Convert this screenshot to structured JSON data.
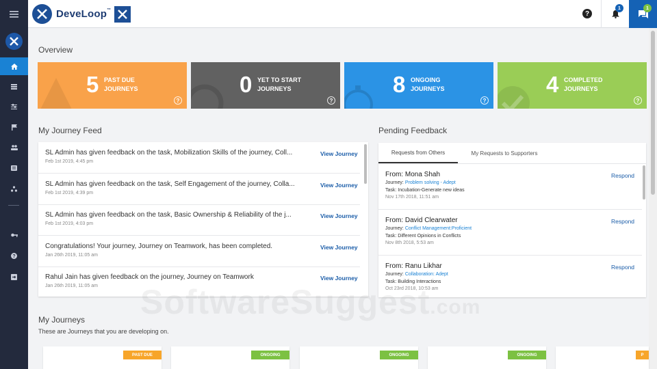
{
  "app": {
    "brand_name": "DeveLoop",
    "brand_tm": "™"
  },
  "sidebar": {
    "items": [
      {
        "name": "home",
        "icon": "home-icon"
      },
      {
        "name": "journeys",
        "icon": "list-icon"
      },
      {
        "name": "filters",
        "icon": "sliders-icon"
      },
      {
        "name": "flags",
        "icon": "flag-icon"
      },
      {
        "name": "people",
        "icon": "people-icon"
      },
      {
        "name": "feedback",
        "icon": "message-icon"
      },
      {
        "name": "network",
        "icon": "network-icon"
      },
      {
        "name": "keys",
        "icon": "key-icon"
      },
      {
        "name": "help",
        "icon": "help-icon"
      },
      {
        "name": "logout",
        "icon": "exit-icon"
      }
    ]
  },
  "topbar": {
    "notification_count": "1",
    "message_count": "1",
    "help_label": "?"
  },
  "overview": {
    "title": "Overview",
    "cards": [
      {
        "value": "5",
        "line1": "PAST DUE",
        "line2": "JOURNEYS",
        "color": "#f9a24a"
      },
      {
        "value": "0",
        "line1": "YET TO START",
        "line2": "JOURNEYS",
        "color": "#616161"
      },
      {
        "value": "8",
        "line1": "ONGOING",
        "line2": "JOURNEYS",
        "color": "#2b93e5"
      },
      {
        "value": "4",
        "line1": "COMPLETED",
        "line2": "JOURNEYS",
        "color": "#9acd56"
      }
    ]
  },
  "feed": {
    "title": "My Journey Feed",
    "link_label": "View Journey",
    "rows": [
      {
        "text": "SL Admin has given feedback on the task, Mobilization Skills of the journey, Coll...",
        "date": "Feb 1st 2019, 4:45 pm"
      },
      {
        "text": "SL Admin has given feedback on the task, Self Engagement of the journey, Colla...",
        "date": "Feb 1st 2019, 4:39 pm"
      },
      {
        "text": "SL Admin has given feedback on the task, Basic Ownership & Reliability of the j...",
        "date": "Feb 1st 2019, 4:03 pm"
      },
      {
        "text": "Congratulations! Your journey, Journey on Teamwork, has been completed.",
        "date": "Jan 26th 2019, 11:05 am"
      },
      {
        "text": "Rahul Jain has given feedback on the journey, Journey on Teamwork",
        "date": "Jan 26th 2019, 11:05 am"
      }
    ]
  },
  "pending": {
    "title": "Pending Feedback",
    "tabs": [
      "Requests from Others",
      "My Requests to Supporters"
    ],
    "respond_label": "Respond",
    "journey_prefix": "Journey:",
    "task_prefix": "Task:",
    "requests": [
      {
        "from": "From: Mona Shah",
        "journey": "Problem solving - Adept",
        "task": "Incubation-Generate new ideas",
        "date": "Nov 17th 2018, 11:51 am"
      },
      {
        "from": "From: David Clearwater",
        "journey": "Conflict Management:Proficient",
        "task": "Different Opinions in Conflicts",
        "date": "Nov 8th 2018, 5:53 am"
      },
      {
        "from": "From: Ranu Likhar",
        "journey": "Collaboration: Adept",
        "task": "Building Interactions",
        "date": "Oct 23rd 2018, 10:53 am"
      }
    ]
  },
  "my_journeys": {
    "title": "My Journeys",
    "subtitle": "These are Journeys that you are developing on.",
    "cards": [
      {
        "status": "PAST DUE",
        "color": "#f7a52a"
      },
      {
        "status": "ONGOING",
        "color": "#7cc142"
      },
      {
        "status": "ONGOING",
        "color": "#7cc142"
      },
      {
        "status": "ONGOING",
        "color": "#7cc142"
      },
      {
        "status": "P",
        "color": "#f7a52a"
      }
    ]
  },
  "watermark": {
    "main": "SoftwareSuggest",
    "suffix": ".com"
  }
}
